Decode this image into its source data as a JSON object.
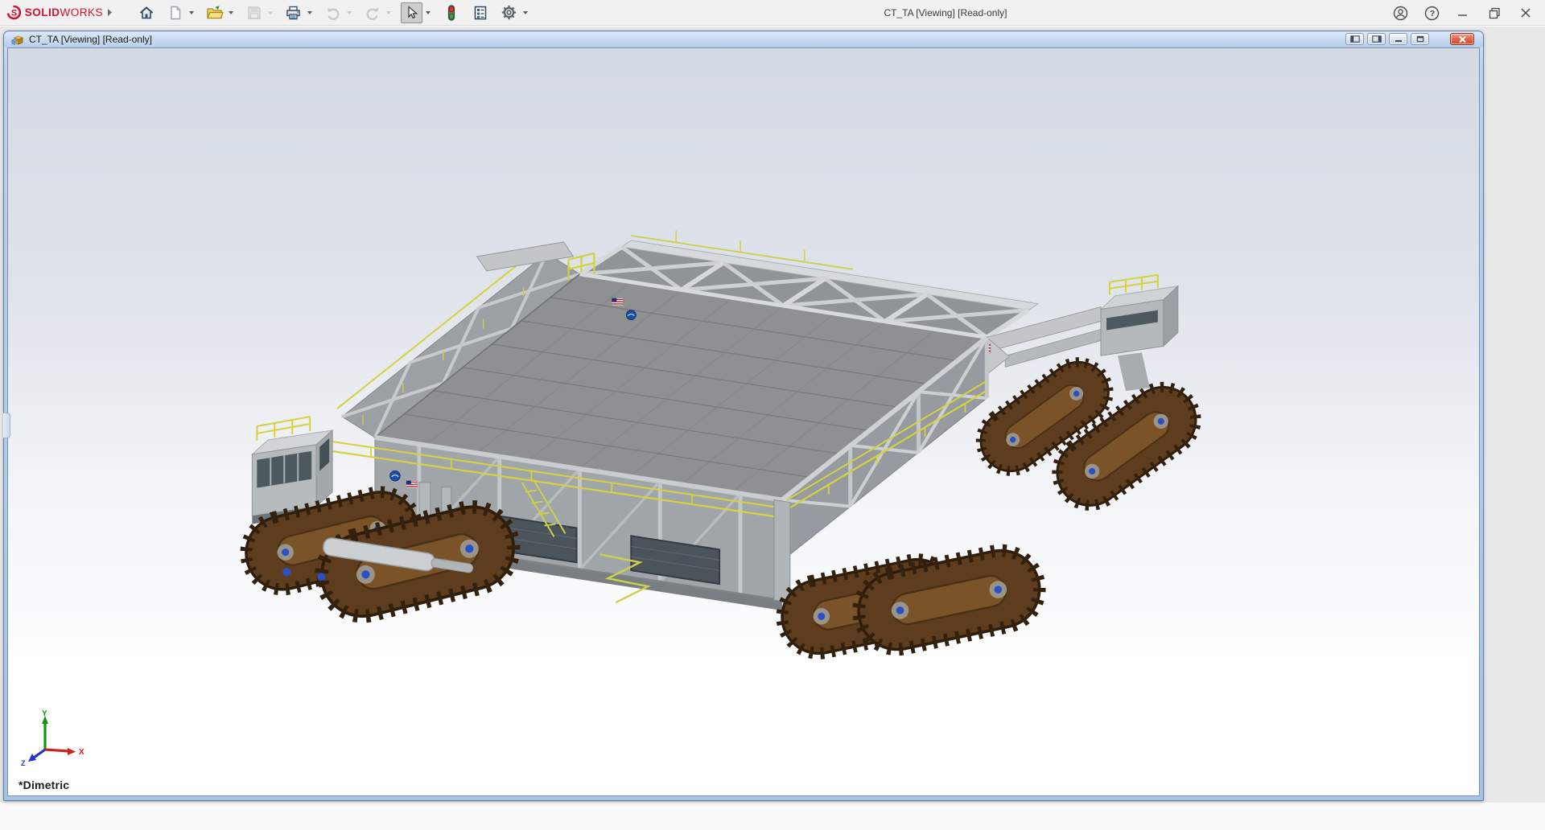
{
  "app": {
    "brand": {
      "solid": "SOLID",
      "works": "WORKS"
    },
    "window_title": "CT_TA [Viewing] [Read-only]",
    "toolbar_items": [
      "home",
      "new-document",
      "open-document",
      "save",
      "print",
      "undo",
      "redo",
      "select",
      "rebuild-traffic-light",
      "file-properties",
      "options"
    ],
    "titlebar_controls": [
      "user-account",
      "help",
      "minimize",
      "restore-down",
      "close"
    ]
  },
  "document_window": {
    "title": "CT_TA [Viewing] [Read-only]",
    "controls": [
      "toggle-left-pane",
      "toggle-right-pane",
      "minimize",
      "restore",
      "close"
    ],
    "viewport": {
      "view_orientation": "*Dimetric",
      "triad": {
        "x": "X",
        "y": "Y",
        "z": "Z"
      },
      "model_description": "NASA crawler-transporter assembly shown in dimetric view"
    }
  },
  "palette": {
    "header-bg": "#f1f1f1",
    "brand-red": "#d6102c",
    "mdi-bg": "#e9e9e9",
    "frame-blue": "#bcd2ec",
    "frame-border": "#5f7ea6",
    "titlebar-top": "#dbe8f8",
    "titlebar-bottom": "#b7cdea",
    "close-red": "#cf4a30",
    "viewport-top": "#d4dae4",
    "viewport-bottom": "#ffffff",
    "deck-gray": "#8e9192",
    "truss-light": "#c7cbcd",
    "wall-gray": "#9fa5a9",
    "track-brown": "#5d3d1e",
    "track-dark": "#2f1d0b",
    "railing-yellow": "#d6d23c",
    "triad-x": "#cf2020",
    "triad-y": "#129312",
    "triad-z": "#2233cc"
  }
}
